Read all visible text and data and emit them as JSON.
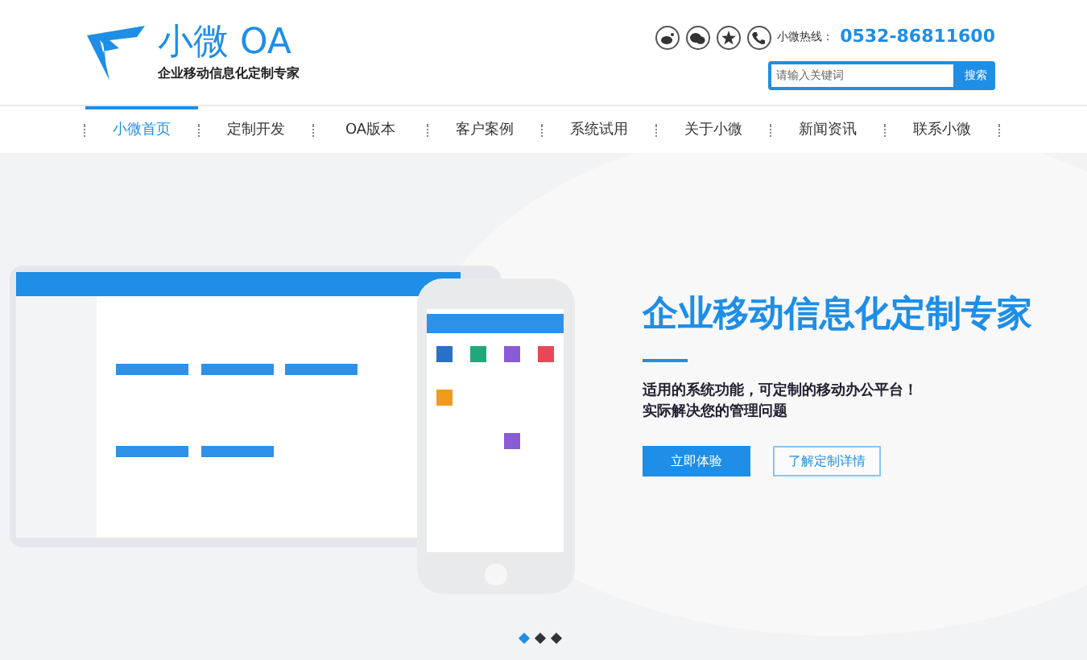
{
  "header": {
    "logo": {
      "name": "小微 OA",
      "tagline": "企业移动信息化定制专家"
    },
    "hotline": {
      "label": "小微热线：",
      "number": "0532-86811600"
    },
    "search": {
      "placeholder": "请输入关键词",
      "button": "搜索"
    }
  },
  "nav": [
    {
      "label": "小微首页",
      "selected": true
    },
    {
      "label": "定制开发",
      "selected": false
    },
    {
      "label": "OA版本",
      "selected": false
    },
    {
      "label": "客户案例",
      "selected": false
    },
    {
      "label": "系统试用",
      "selected": false
    },
    {
      "label": "关于小微",
      "selected": false
    },
    {
      "label": "新闻资讯",
      "selected": false
    },
    {
      "label": "联系小微",
      "selected": false
    }
  ],
  "hero": {
    "kind": "picture",
    "title": "企业移动信息化定制专家",
    "lines": [
      "适用的系统功能，可定制的移动办公平台！",
      "实际解决您的管理问题"
    ],
    "buttons": [
      {
        "label": "立即体验",
        "kind": "primary"
      },
      {
        "label": "了解定制详情",
        "kind": "outline"
      }
    ]
  },
  "carousel": [
    {
      "selected": true
    },
    {
      "selected": false
    },
    {
      "selected": false
    }
  ]
}
